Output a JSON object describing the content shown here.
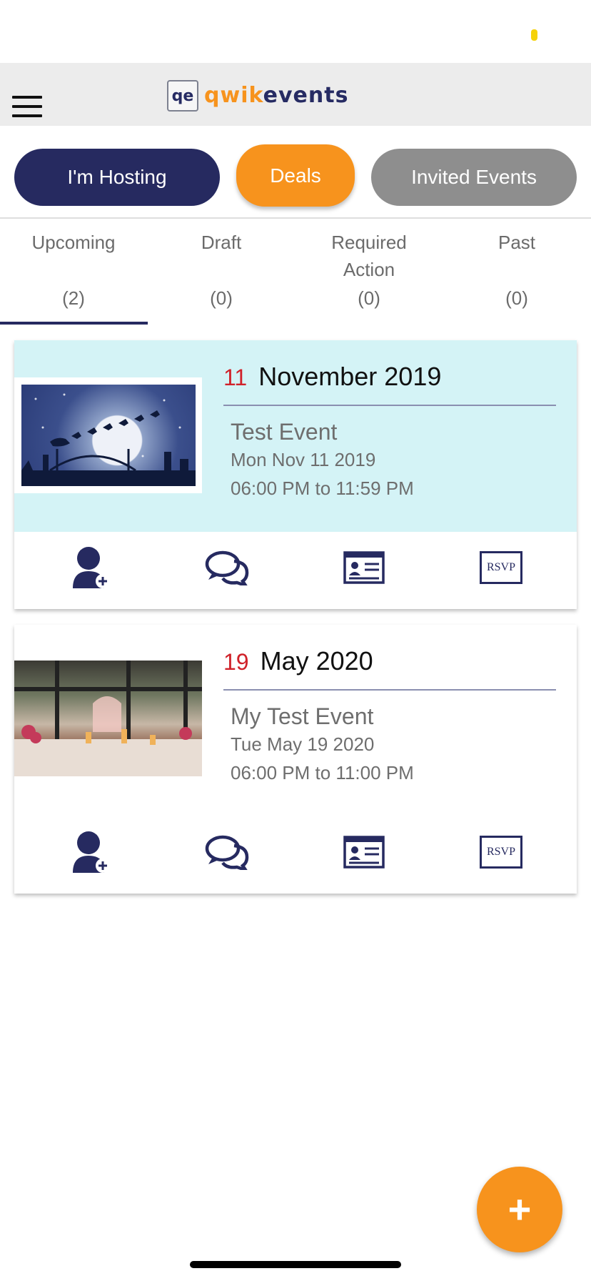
{
  "header": {
    "logo_mark": "qe",
    "logo_qwik": "qwik",
    "logo_events": "events"
  },
  "segments": {
    "hosting": "I'm Hosting",
    "deals": "Deals",
    "invited": "Invited Events",
    "selected": "I'm Hosting"
  },
  "subtabs": [
    {
      "label": "Upcoming",
      "count": "(2)",
      "active": true
    },
    {
      "label": "Draft",
      "count": "(0)",
      "active": false
    },
    {
      "label": "Required Action",
      "count": "(0)",
      "active": false
    },
    {
      "label": "Past",
      "count": "(0)",
      "active": false
    }
  ],
  "events": [
    {
      "day": "11",
      "month_year": "November 2019",
      "title": "Test Event",
      "date": "Mon Nov 11 2019",
      "time": "06:00 PM to 11:59 PM",
      "highlighted": true,
      "image": "santa-sleigh-moon-image"
    },
    {
      "day": "19",
      "month_year": "May 2020",
      "title": "My Test Event",
      "date": "Tue May 19 2020",
      "time": "06:00 PM to 11:00 PM",
      "highlighted": false,
      "image": "dinner-table-candles-image"
    }
  ],
  "actions": {
    "icons": [
      "add-guest-icon",
      "chat-icon",
      "id-card-icon",
      "rsvp-icon"
    ],
    "rsvp_label": "RSVP"
  },
  "fab": {
    "label": "+"
  },
  "colors": {
    "navy": "#262a60",
    "orange": "#f7931d",
    "gray": "#8e8e8e",
    "highlight": "#d4f3f6",
    "day_red": "#d0222a"
  }
}
